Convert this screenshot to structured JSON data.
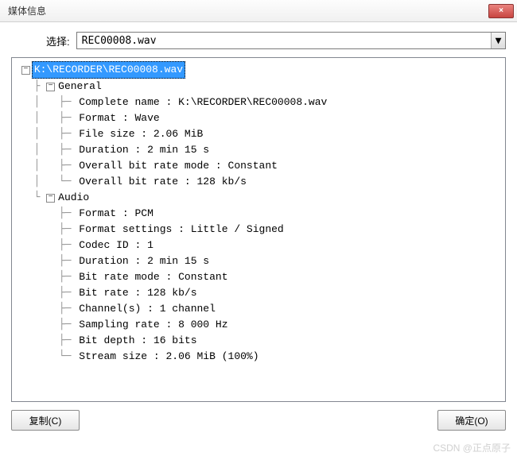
{
  "title": "媒体信息",
  "close_x": "×",
  "selector": {
    "label": "选择:",
    "value": "REC00008.wav",
    "arrow": "▼"
  },
  "tree": {
    "root": "K:\\RECORDER\\REC00008.wav",
    "sections": [
      {
        "name": "General",
        "items": [
          "Complete name : K:\\RECORDER\\REC00008.wav",
          "Format : Wave",
          "File size : 2.06 MiB",
          "Duration : 2 min 15 s",
          "Overall bit rate mode : Constant",
          "Overall bit rate : 128 kb/s"
        ]
      },
      {
        "name": "Audio",
        "items": [
          "Format : PCM",
          "Format settings : Little / Signed",
          "Codec ID : 1",
          "Duration : 2 min 15 s",
          "Bit rate mode : Constant",
          "Bit rate : 128 kb/s",
          "Channel(s) : 1 channel",
          "Sampling rate : 8 000 Hz",
          "Bit depth : 16 bits",
          "Stream size : 2.06 MiB (100%)"
        ]
      }
    ]
  },
  "buttons": {
    "copy": "复制(C)",
    "ok": "确定(O)"
  },
  "watermark": "CSDN @正点原子",
  "expander_symbol": "−"
}
